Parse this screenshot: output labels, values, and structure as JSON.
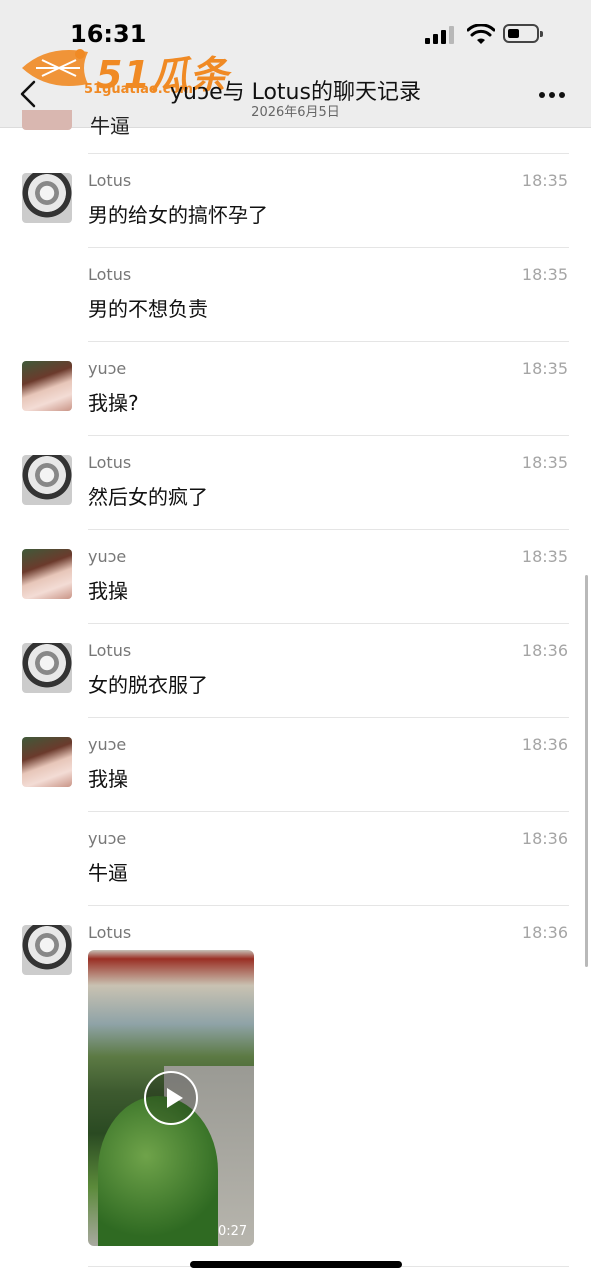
{
  "status_bar": {
    "time": "16:31"
  },
  "header": {
    "title": "yuɔe与 Lotus的聊天记录",
    "date": "2026年6月5日"
  },
  "watermark": {
    "brand": "51瓜条",
    "url": "51guatiao.com"
  },
  "previous_fragment": "牛逼",
  "messages": [
    {
      "sender": "Lotus",
      "time": "18:35",
      "text": "男的给女的搞怀孕了",
      "avatar": "lotus"
    },
    {
      "sender": "Lotus",
      "time": "18:35",
      "text": "男的不想负责",
      "avatar": "none"
    },
    {
      "sender": "yuɔe",
      "time": "18:35",
      "text": "我操?",
      "avatar": "yuxe"
    },
    {
      "sender": "Lotus",
      "time": "18:35",
      "text": "然后女的疯了",
      "avatar": "lotus"
    },
    {
      "sender": "yuɔe",
      "time": "18:35",
      "text": "我操",
      "avatar": "yuxe"
    },
    {
      "sender": "Lotus",
      "time": "18:36",
      "text": "女的脱衣服了",
      "avatar": "lotus"
    },
    {
      "sender": "yuɔe",
      "time": "18:36",
      "text": "我操",
      "avatar": "yuxe"
    },
    {
      "sender": "yuɔe",
      "time": "18:36",
      "text": "牛逼",
      "avatar": "none"
    }
  ],
  "video_message": {
    "sender": "Lotus",
    "time": "18:36",
    "duration": "0:27"
  }
}
